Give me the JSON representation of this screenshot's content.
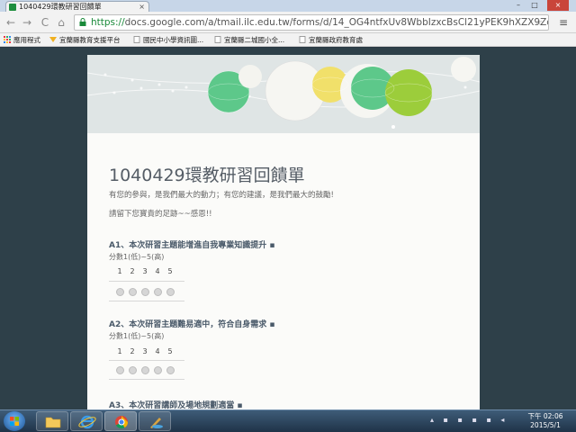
{
  "browser": {
    "tab_title": "1040429環教研習回饋單",
    "tab_close": "×",
    "url_https": "https://",
    "url_rest": "docs.google.com/a/tmail.ilc.edu.tw/forms/d/14_OG4ntfxUv8WbbIzxcBsCl21yPEK9hXZX9Zdufjuyk",
    "back": "←",
    "forward": "→",
    "reload": "C",
    "home": "⌂",
    "menu": "≡",
    "minimize": "–",
    "maximize": "□",
    "close": "×",
    "bookmarks": [
      {
        "label": "應用程式"
      },
      {
        "label": "宜蘭縣教育支援平台"
      },
      {
        "label": "國民中小學資訊圖..."
      },
      {
        "label": "宜蘭縣二城國小全..."
      },
      {
        "label": "宜蘭縣政府教育處"
      }
    ]
  },
  "form": {
    "title": "1040429環教研習回饋單",
    "description_1": "有您的參與，是我們最大的動力；有您的建議，是我們最大的鼓勵!",
    "description_2": "請留下您寶貴的足跡~~感恩!!",
    "questions": [
      {
        "title": "A1、本次研習主題能增進自我專業知識提升 ▪",
        "scale_label": "分數1(低)~5(高)",
        "options": [
          "1",
          "2",
          "3",
          "4",
          "5"
        ]
      },
      {
        "title": "A2、本次研習主題難易適中，符合自身需求 ▪",
        "scale_label": "分數1(低)~5(高)",
        "options": [
          "1",
          "2",
          "3",
          "4",
          "5"
        ]
      },
      {
        "title": "A3、本次研習講師及場地規劃適當 ▪"
      }
    ]
  },
  "taskbar": {
    "time": "下午 02:06",
    "date": "2015/5/1",
    "apps": [
      "file-explorer",
      "internet-explorer",
      "chrome",
      "paint"
    ]
  },
  "colors": {
    "page_background": "#2e4049",
    "card_background": "#fbfbf9",
    "title_color": "#555d66",
    "lantern_green": "#5dc88a",
    "lantern_yellow": "#f1e06a",
    "lantern_lime": "#9ccd3b"
  }
}
